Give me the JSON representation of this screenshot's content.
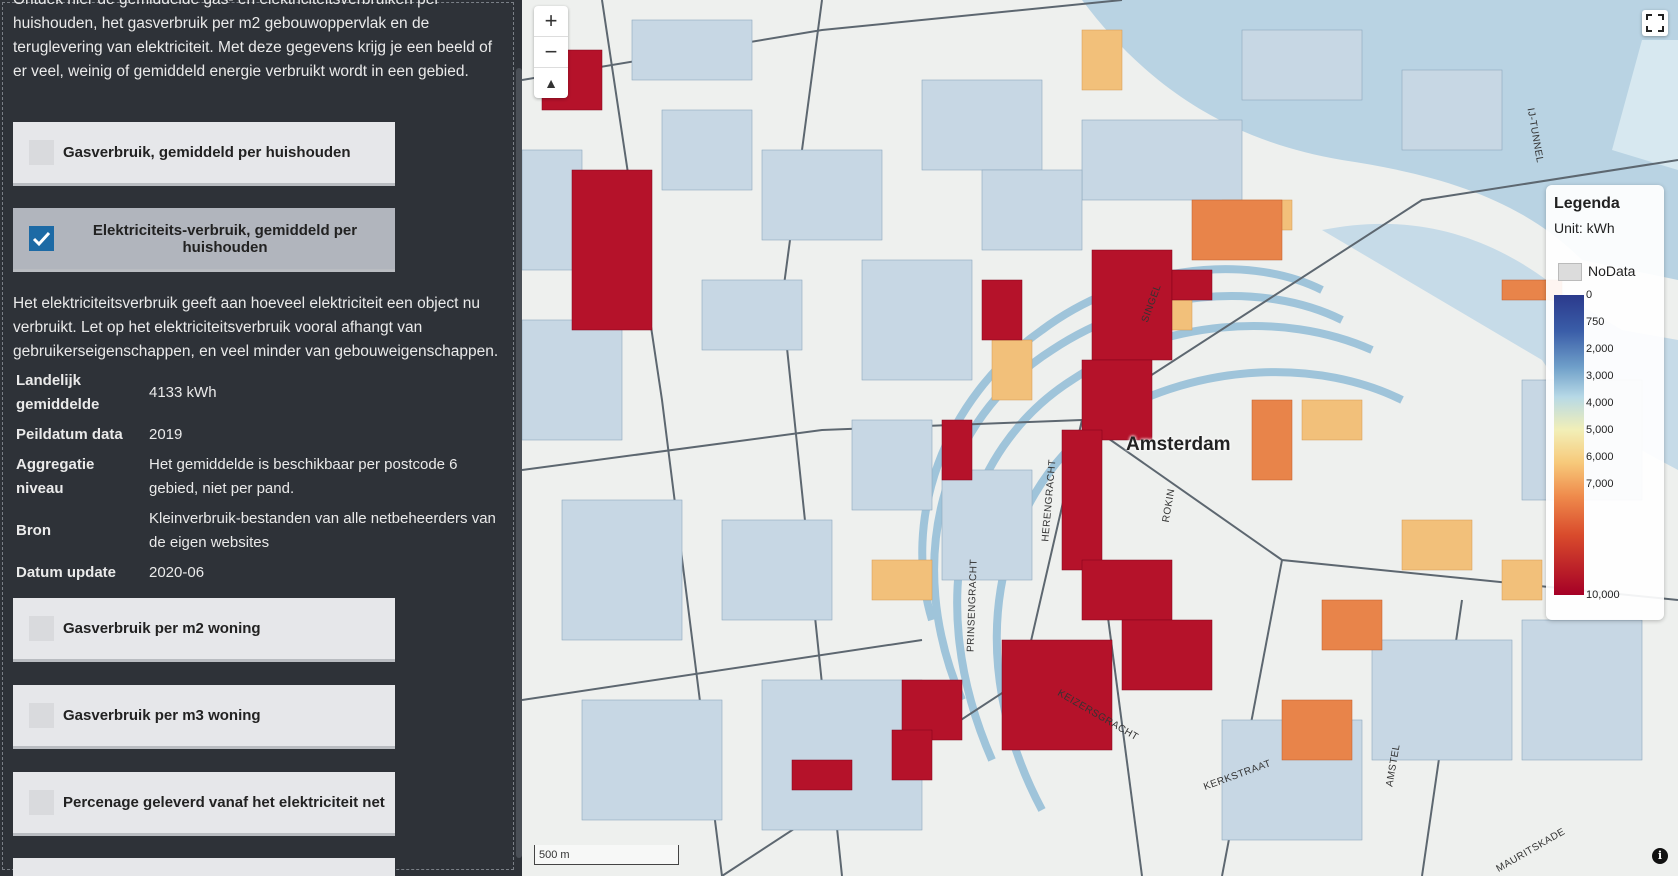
{
  "sidebar": {
    "intro": "Ontdek hier de gemiddelde gas- en elektriciteitsverbruiken per huishouden, het gasverbruik per m2 gebouwoppervlak en de teruglevering van elektriciteit. Met deze gegevens krijg je een beeld of er veel, weinig of gemiddeld energie verbruikt wordt in een gebied.",
    "layers": [
      {
        "label": "Gasverbruik, gemiddeld per huishouden",
        "checked": false
      },
      {
        "label": "Elektriciteits-verbruik, gemiddeld per huishouden",
        "checked": true
      },
      {
        "label": "Gasverbruik per m2 woning",
        "checked": false
      },
      {
        "label": "Gasverbruik per m3 woning",
        "checked": false
      },
      {
        "label": "Percenage geleverd vanaf het elektriciteit net",
        "checked": false
      }
    ],
    "description": "Het elektriciteitsverbruik geeft aan hoeveel elektriciteit een object nu verbruikt. Let op het elektriciteitsverbruik vooral afhangt van gebruikerseigenschappen, en veel minder van gebouweigenschappen.",
    "meta": [
      {
        "key": "Landelijk gemiddelde",
        "value": "4133 kWh"
      },
      {
        "key": "Peildatum data",
        "value": "2019"
      },
      {
        "key": "Aggregatie niveau",
        "value": "Het gemiddelde is beschikbaar per postcode 6 gebied, niet per pand."
      },
      {
        "key": "Bron",
        "value": "Kleinverbruik-bestanden van alle netbeheerders van de eigen websites"
      },
      {
        "key": "Datum update",
        "value": "2020-06"
      }
    ]
  },
  "map": {
    "zoom_in": "+",
    "zoom_out": "−",
    "north": "▲",
    "city_label": "Amsterdam",
    "street_labels": [
      "SINGEL",
      "HERENGRACHT",
      "PRINSENGRACHT",
      "KEIZERSGRACHT",
      "KERKSTRAAT",
      "AMSTEL",
      "ROKIN",
      "IJ-TUNNEL",
      "MAURITSKADE"
    ],
    "scale_label": "500 m",
    "info": "i"
  },
  "legend": {
    "title": "Legenda",
    "unit": "Unit: kWh",
    "nodata": "NoData",
    "ticks": [
      "0",
      "750",
      "2,000",
      "3,000",
      "4,000",
      "5,000",
      "6,000",
      "7,000",
      "10,000"
    ],
    "tick_values": [
      0,
      750,
      2000,
      3000,
      4000,
      5000,
      6000,
      7000,
      10000
    ],
    "colors": [
      "#2b3a8c",
      "#6f9fc9",
      "#f2efb7",
      "#ef8b4c",
      "#a50026"
    ]
  }
}
